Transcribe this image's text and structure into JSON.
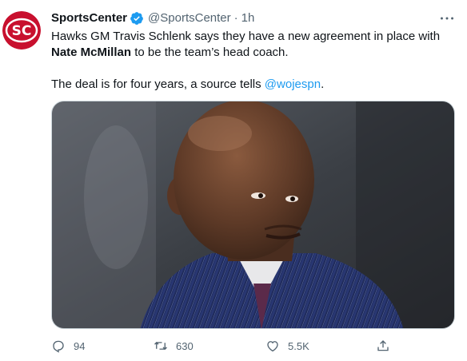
{
  "account": {
    "name": "SportsCenter",
    "handle": "@SportsCenter",
    "separator": "·",
    "time": "1h",
    "avatar_text": "SC"
  },
  "tweet": {
    "line1_text": "Hawks GM Travis Schlenk says they have a new agreement in place with",
    "line2_bold": "Nate McMillan",
    "line2_rest": " to be the team’s head coach.",
    "line3_text": "The deal is for four years, a source tells ",
    "mention": "@wojespn",
    "line3_end": "."
  },
  "actions": {
    "replies": "94",
    "retweets": "630",
    "likes": "5.5K"
  },
  "colors": {
    "accent": "#1d9bf0",
    "muted": "#536471",
    "brand_red": "#c8102e"
  },
  "icons": [
    "more-icon",
    "verified-badge-icon",
    "reply-icon",
    "retweet-icon",
    "like-icon",
    "share-icon"
  ]
}
